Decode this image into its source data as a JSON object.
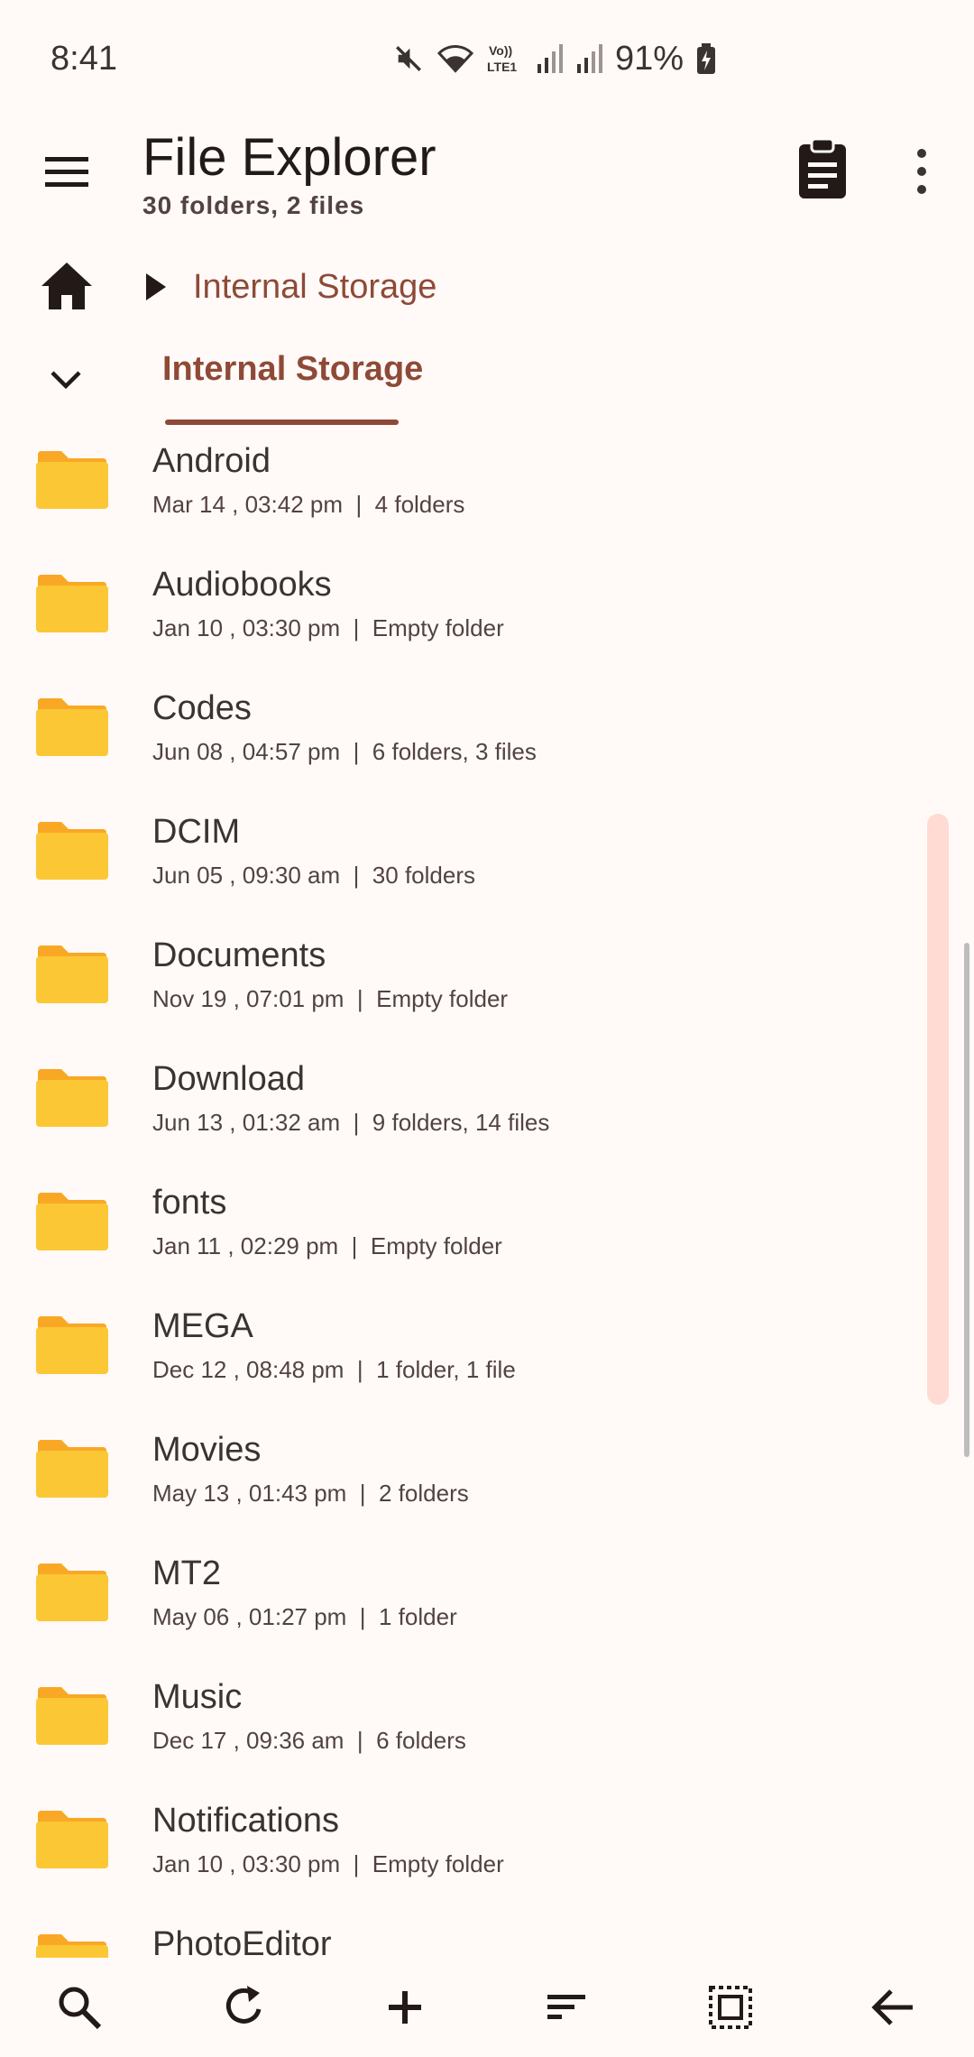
{
  "status_bar": {
    "time": "8:41",
    "battery": "91%",
    "icons": [
      "mute-icon",
      "wifi-icon",
      "volte-icon",
      "signal-icon",
      "signal-icon",
      "battery-charging-icon"
    ],
    "volte_label_top": "Vo))",
    "volte_label_bottom": "LTE1"
  },
  "app_bar": {
    "title": "File Explorer",
    "subtitle": "30 folders, 2 files"
  },
  "breadcrumb": {
    "label": "Internal Storage"
  },
  "tabs": [
    {
      "label": "Internal Storage",
      "active": true
    }
  ],
  "files": [
    {
      "name": "Android",
      "date": "Mar 14 , 03:42 pm",
      "info": "4 folders"
    },
    {
      "name": "Audiobooks",
      "date": "Jan 10 , 03:30 pm",
      "info": "Empty folder"
    },
    {
      "name": "Codes",
      "date": "Jun 08 , 04:57 pm",
      "info": "6 folders, 3 files"
    },
    {
      "name": "DCIM",
      "date": "Jun 05 , 09:30 am",
      "info": "30 folders"
    },
    {
      "name": "Documents",
      "date": "Nov 19 , 07:01 pm",
      "info": "Empty folder"
    },
    {
      "name": "Download",
      "date": "Jun 13 , 01:32 am",
      "info": "9 folders, 14 files"
    },
    {
      "name": "fonts",
      "date": "Jan 11 , 02:29 pm",
      "info": "Empty folder"
    },
    {
      "name": "MEGA",
      "date": "Dec 12 , 08:48 pm",
      "info": "1 folder, 1 file"
    },
    {
      "name": "Movies",
      "date": "May 13 , 01:43 pm",
      "info": "2 folders"
    },
    {
      "name": "MT2",
      "date": "May 06 , 01:27 pm",
      "info": "1 folder"
    },
    {
      "name": "Music",
      "date": "Dec 17 , 09:36 am",
      "info": "6 folders"
    },
    {
      "name": "Notifications",
      "date": "Jan 10 , 03:30 pm",
      "info": "Empty folder"
    },
    {
      "name": "PhotoEditor",
      "date": "",
      "info": ""
    }
  ],
  "bottom_bar": {
    "icons": [
      "search-icon",
      "refresh-icon",
      "add-icon",
      "sort-icon",
      "select-all-icon",
      "back-arrow-icon"
    ]
  },
  "colors": {
    "accent": "#8e4a37",
    "folder": "#fcc734",
    "folder_tab": "#f9a825",
    "scroll_track": "#ffdbd3",
    "background": "#fffaf8"
  }
}
